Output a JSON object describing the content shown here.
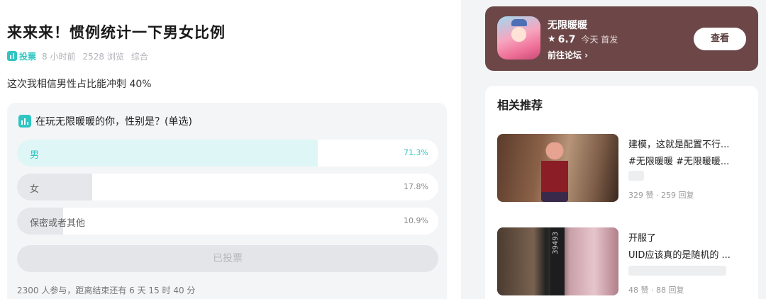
{
  "post": {
    "title": "来来来！惯例统计一下男女比例",
    "vote_chip": "投票",
    "time": "8 小时前",
    "views": "2528 浏览",
    "category": "综合",
    "body": "这次我相信男性占比能冲刺 40%"
  },
  "poll": {
    "question": "在玩无限暖暖的你，性别是？(单选)",
    "options": [
      {
        "label": "男",
        "percent": "71.3%",
        "value": 0.713,
        "selected": true
      },
      {
        "label": "女",
        "percent": "17.8%",
        "value": 0.178,
        "selected": false
      },
      {
        "label": "保密或者其他",
        "percent": "10.9%",
        "value": 0.109,
        "selected": false
      }
    ],
    "voted_label": "已投票",
    "footer": "2300 人参与，距离结束还有 6 天 15 时 40 分",
    "colors": {
      "selected_fill": "#dff6f6",
      "other_fill": "#e6e7ea",
      "accent": "#2ec5c2"
    }
  },
  "game": {
    "name": "无限暖暖",
    "star": "★",
    "score": "6.7",
    "status": "今天 首发",
    "link": "前往论坛 ›",
    "view_button": "查看",
    "card_color": "#6d4748"
  },
  "related": {
    "title": "相关推荐",
    "items": [
      {
        "line1": "建模，这就是配置不行...",
        "line2": "#无限暖暖 #无限暖暖...",
        "stats": "329 赞 · 259 回复"
      },
      {
        "line1": "开服了",
        "line2": "UID应该真的是随机的 ...",
        "stats": "48 赞 · 88 回复",
        "thumb_text": "39493"
      }
    ]
  }
}
